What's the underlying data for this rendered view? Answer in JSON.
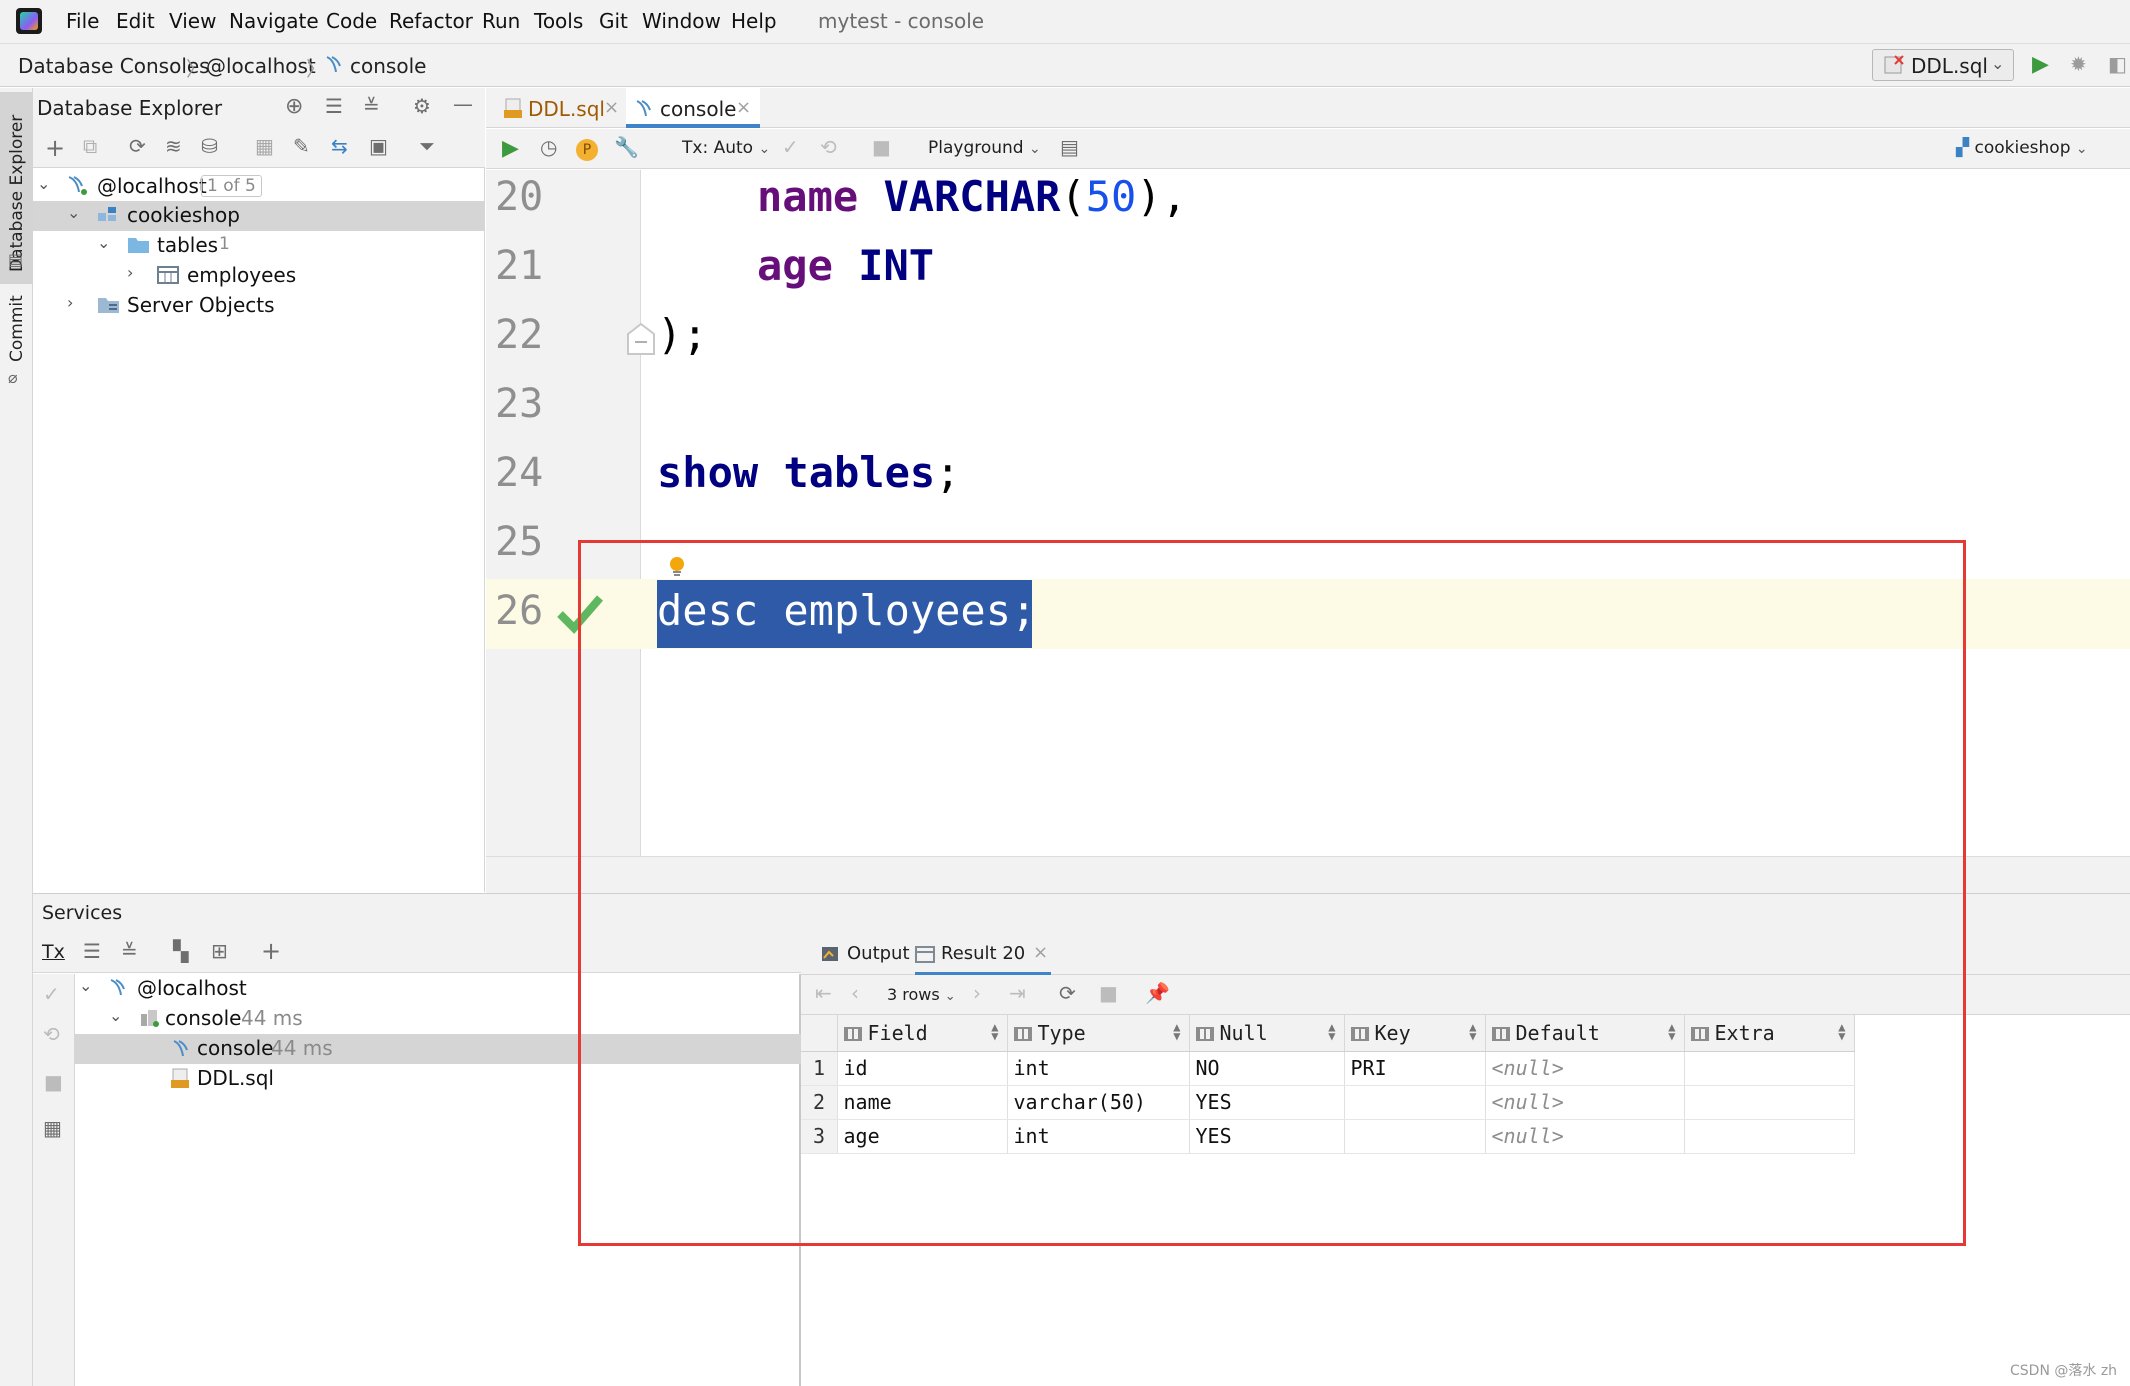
{
  "menu": {
    "items": [
      "File",
      "Edit",
      "View",
      "Navigate",
      "Code",
      "Refactor",
      "Run",
      "Tools",
      "Git",
      "Window",
      "Help"
    ],
    "window_title": "mytest - console"
  },
  "breadcrumb": {
    "items": [
      "Database Consoles",
      "@localhost",
      "console"
    ]
  },
  "run_config": {
    "label": "DDL.sql"
  },
  "left_strip": {
    "database_explorer": "Database Explorer",
    "commit": "Commit"
  },
  "db_explorer": {
    "title": "Database Explorer",
    "tree": {
      "host": "@localhost",
      "host_badge": "1 of 5",
      "schema": "cookieshop",
      "tables_label": "tables",
      "tables_count": "1",
      "table": "employees",
      "server_objects": "Server Objects"
    }
  },
  "editor": {
    "tabs": [
      {
        "label": "DDL.sql"
      },
      {
        "label": "console"
      }
    ],
    "toolbar": {
      "tx_mode": "Tx: Auto",
      "playground": "Playground",
      "schema": "cookieshop"
    },
    "lines": [
      {
        "num": "20"
      },
      {
        "num": "21"
      },
      {
        "num": "22"
      },
      {
        "num": "23"
      },
      {
        "num": "24"
      },
      {
        "num": "25"
      },
      {
        "num": "26"
      }
    ],
    "code": {
      "l20_name": "name",
      "l20_type": "VARCHAR",
      "l20_open": "(",
      "l20_num": "50",
      "l20_close": "),",
      "l21_name": "age",
      "l21_type": "INT",
      "l22": ");",
      "l24_show": "show",
      "l24_tables": "tables",
      "l24_semi": ";",
      "l26": "desc employees;"
    }
  },
  "services": {
    "title": "Services",
    "toolbar": {
      "tx": "Tx"
    },
    "tree": {
      "host": "@localhost",
      "console_group": "console",
      "console_group_time": "44 ms",
      "console_item": "console",
      "console_item_time": "44 ms",
      "ddl": "DDL.sql"
    }
  },
  "results": {
    "tabs": {
      "output": "Output",
      "result": "Result 20"
    },
    "rows_label": "3 rows",
    "columns": [
      "Field",
      "Type",
      "Null",
      "Key",
      "Default",
      "Extra"
    ],
    "rows": [
      {
        "n": "1",
        "field": "id",
        "type": "int",
        "null": "NO",
        "key": "PRI",
        "default": "<null>",
        "extra": ""
      },
      {
        "n": "2",
        "field": "name",
        "type": "varchar(50)",
        "null": "YES",
        "key": "",
        "default": "<null>",
        "extra": ""
      },
      {
        "n": "3",
        "field": "age",
        "type": "int",
        "null": "YES",
        "key": "",
        "default": "<null>",
        "extra": ""
      }
    ]
  },
  "watermark": "CSDN @落水 zh",
  "colors": {
    "accent": "#4083c9",
    "selection": "#2e5aa8",
    "annotation": "#e53935",
    "keyword": "#000080",
    "identifier": "#660e7a",
    "number": "#1750eb",
    "run_green": "#3e9a3e"
  }
}
